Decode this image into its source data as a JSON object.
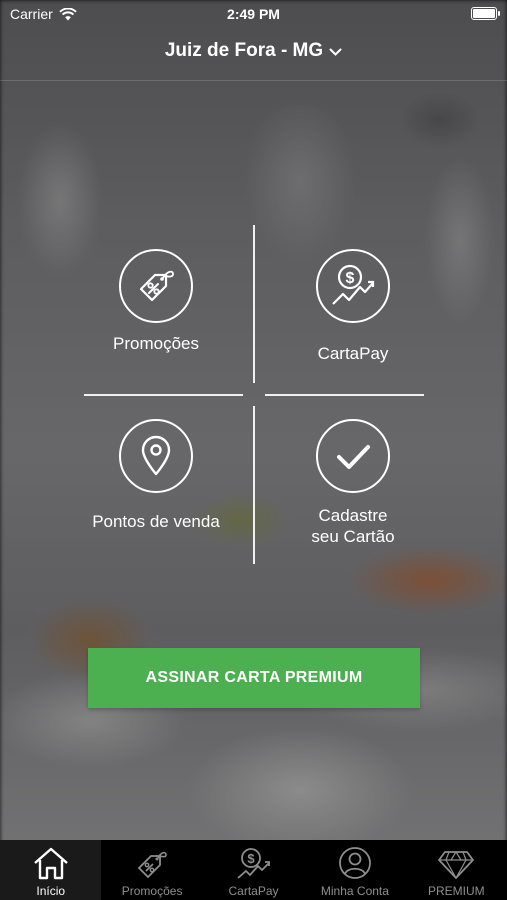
{
  "status_bar": {
    "carrier": "Carrier",
    "time": "2:49 PM"
  },
  "header": {
    "city": "Juiz de Fora - MG"
  },
  "menu": {
    "promocoes": "Promoções",
    "cartapay": "CartaPay",
    "pontos": "Pontos de venda",
    "cadastre": "Cadastre\nseu Cartão"
  },
  "cta": {
    "label": "ASSINAR CARTA PREMIUM"
  },
  "tabs": [
    {
      "label": "Início",
      "icon": "home-icon",
      "active": true
    },
    {
      "label": "Promoções",
      "icon": "tag-icon"
    },
    {
      "label": "CartaPay",
      "icon": "coin-chart-icon"
    },
    {
      "label": "Minha Conta",
      "icon": "user-icon"
    },
    {
      "label": "PREMIUM",
      "icon": "diamond-icon"
    }
  ],
  "colors": {
    "accent": "#4caf50",
    "tabbar": "#000000"
  }
}
